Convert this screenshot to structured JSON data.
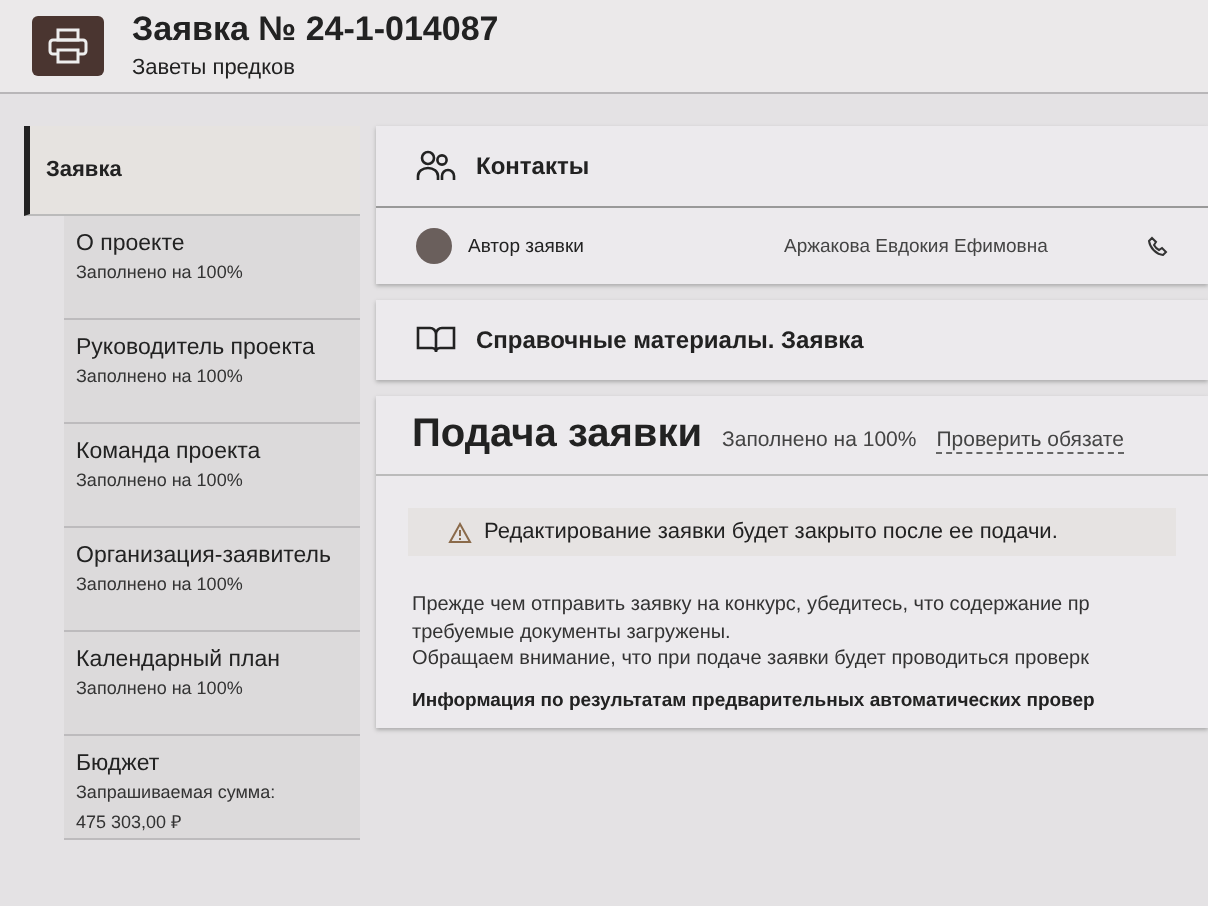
{
  "header": {
    "title": "Заявка № 24-1-014087",
    "subtitle": "Заветы предков"
  },
  "sidebar": {
    "section": {
      "label": "Заявка",
      "selected": true
    },
    "items": [
      {
        "label": "О проекте",
        "status": "Заполнено на 100%"
      },
      {
        "label": "Руководитель проекта",
        "status": "Заполнено на 100%"
      },
      {
        "label": "Команда проекта",
        "status": "Заполнено на 100%"
      },
      {
        "label": "Организация-заявитель",
        "status": "Заполнено на 100%"
      },
      {
        "label": "Календарный план",
        "status": "Заполнено на 100%"
      },
      {
        "label": "Бюджет",
        "status": "Запрашиваемая сумма:",
        "amount": "475 303,00 ₽"
      }
    ]
  },
  "contacts": {
    "title": "Контакты",
    "author_label": "Автор заявки",
    "author_name": "Аржакова Евдокия Ефимовна"
  },
  "references": {
    "title": "Справочные материалы. Заявка"
  },
  "submission": {
    "title": "Подача заявки",
    "status": "Заполнено на 100%",
    "check_link": "Проверить обязате",
    "warning": "Редактирование заявки будет закрыто после ее подачи.",
    "lines": [
      "Прежде чем отправить заявку на конкурс, убедитесь, что содержание пр",
      "требуемые документы загружены.",
      "Обращаем внимание, что при подаче заявки будет проводиться проверк"
    ],
    "info_heading": "Информация по результатам предварительных автоматических провер"
  }
}
